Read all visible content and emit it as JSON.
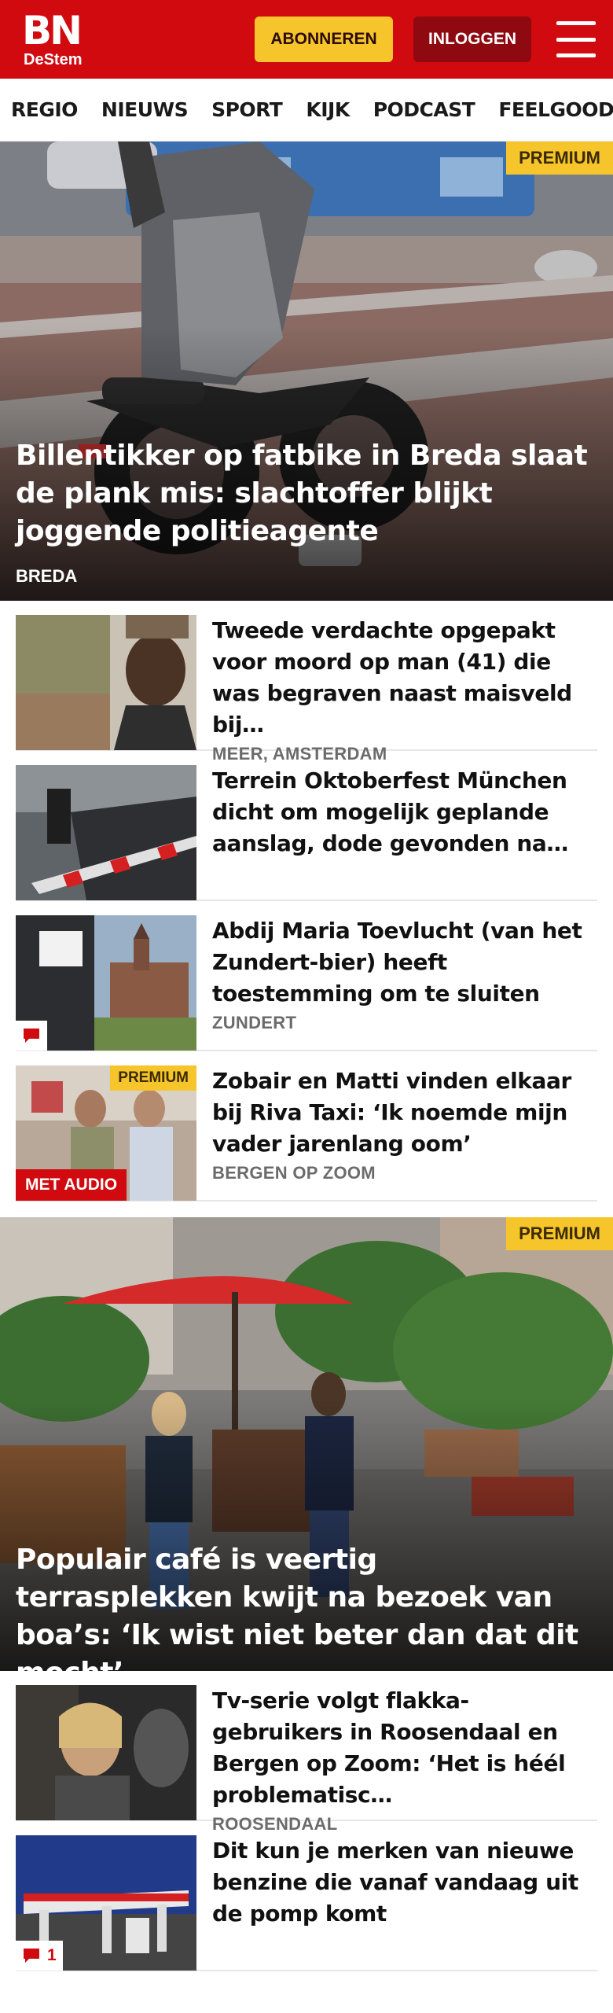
{
  "header": {
    "logo_main": "BN",
    "logo_sub": "DeStem",
    "subscribe_label": "ABONNEREN",
    "login_label": "INLOGGEN",
    "menu_icon": "hamburger-menu-icon"
  },
  "nav": {
    "items": [
      "REGIO",
      "NIEUWS",
      "SPORT",
      "KIJK",
      "PODCAST",
      "FEELGOOD"
    ]
  },
  "hero1": {
    "premium_label": "PREMIUM",
    "title": "Billentikker op fatbike in Breda slaat de plank mis: slachtoffer blijkt joggende politieagente",
    "tag": "BREDA"
  },
  "list1": [
    {
      "title": "Tweede verdachte opgepakt voor moord op man (41) die was begraven naast maisveld bij…",
      "location": "MEER, AMSTERDAM"
    },
    {
      "title": "Terrein Oktoberfest München dicht om mogelijk geplande aanslag, dode gevonden na…",
      "location": ""
    },
    {
      "title": "Abdij Maria Toevlucht (van het Zundert-bier) heeft toestemming om te sluiten",
      "location": "ZUNDERT",
      "comment_icon": "comment-icon"
    },
    {
      "title": "Zobair en Matti vinden elkaar bij Riva Taxi: ‘Ik noemde mijn vader jarenlang oom’",
      "location": "BERGEN OP ZOOM",
      "premium_label": "PREMIUM",
      "audio_label": "MET AUDIO"
    }
  ],
  "hero2": {
    "premium_label": "PREMIUM",
    "title": "Populair café is veertig terrasplekken kwijt na bezoek van boa’s: ‘Ik wist niet beter dan dat dit mocht’"
  },
  "list2": [
    {
      "title": "Tv-serie volgt flakka-gebruikers in Roosendaal en Bergen op Zoom: ‘Het is héél problematisc…",
      "location": "ROOSENDAAL"
    },
    {
      "title": "Dit kun je merken van nieuwe benzine die vanaf vandaag uit de pomp komt",
      "location": "",
      "comment_icon": "comment-icon",
      "comment_count": "1"
    }
  ],
  "colors": {
    "brand_red": "#d10a10",
    "premium_yellow": "#f5c52b",
    "login_dark_red": "#8e0a10"
  }
}
